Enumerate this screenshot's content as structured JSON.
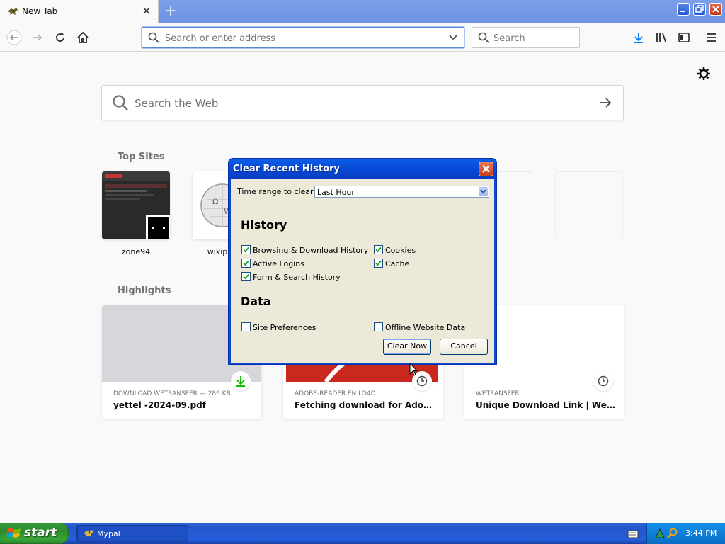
{
  "browser": {
    "tab": {
      "title": "New Tab",
      "close_glyph": "✕"
    },
    "new_tab_glyph": "+",
    "urlbar": {
      "placeholder": "Search or enter address",
      "value": ""
    },
    "searchbar": {
      "placeholder": "Search",
      "value": ""
    },
    "toolbar_icons": [
      "back-icon",
      "forward-icon",
      "reload-icon",
      "home-icon",
      "download-icon",
      "library-icon",
      "sidebar-icon",
      "menu-icon"
    ]
  },
  "newtab": {
    "web_search_placeholder": "Search the Web",
    "top_sites_title": "Top Sites",
    "top_sites": [
      {
        "label": "zone94"
      },
      {
        "label": "wikipe"
      },
      {
        "label": ""
      },
      {
        "label": ""
      }
    ],
    "highlights_title": "Highlights",
    "highlights": [
      {
        "source": "DOWNLOAD.WETRANSFER — 286 KB",
        "title": "yettel -2024-09.pdf",
        "badge": "download-icon"
      },
      {
        "source": "ADOBE-READER.EN.LO4D",
        "title": "Fetching download for Adobe R...",
        "badge": "clock-icon"
      },
      {
        "source": "WETRANSFER",
        "title": "Unique Download Link | WeTran...",
        "badge": "clock-icon"
      }
    ]
  },
  "dialog": {
    "title": "Clear Recent History",
    "time_range_label": "Time range to clear:",
    "time_range_value": "Last Hour",
    "history_heading": "History",
    "history_items": [
      {
        "label": "Browsing & Download History",
        "checked": true
      },
      {
        "label": "Cookies",
        "checked": true
      },
      {
        "label": "Active Logins",
        "checked": true
      },
      {
        "label": "Cache",
        "checked": true
      },
      {
        "label": "Form & Search History",
        "checked": true
      }
    ],
    "data_heading": "Data",
    "data_items": [
      {
        "label": "Site Preferences",
        "checked": false
      },
      {
        "label": "Offline Website Data",
        "checked": false
      }
    ],
    "clear_button": "Clear Now",
    "cancel_button": "Cancel"
  },
  "taskbar": {
    "start_label": "start",
    "task_label": "Mypal",
    "clock": "3:44 PM"
  },
  "colors": {
    "xp_blue": "#245edb",
    "dialog_face": "#ece9d8",
    "firefox_blue": "#0a84ff",
    "start_green": "#2f8a2f"
  }
}
